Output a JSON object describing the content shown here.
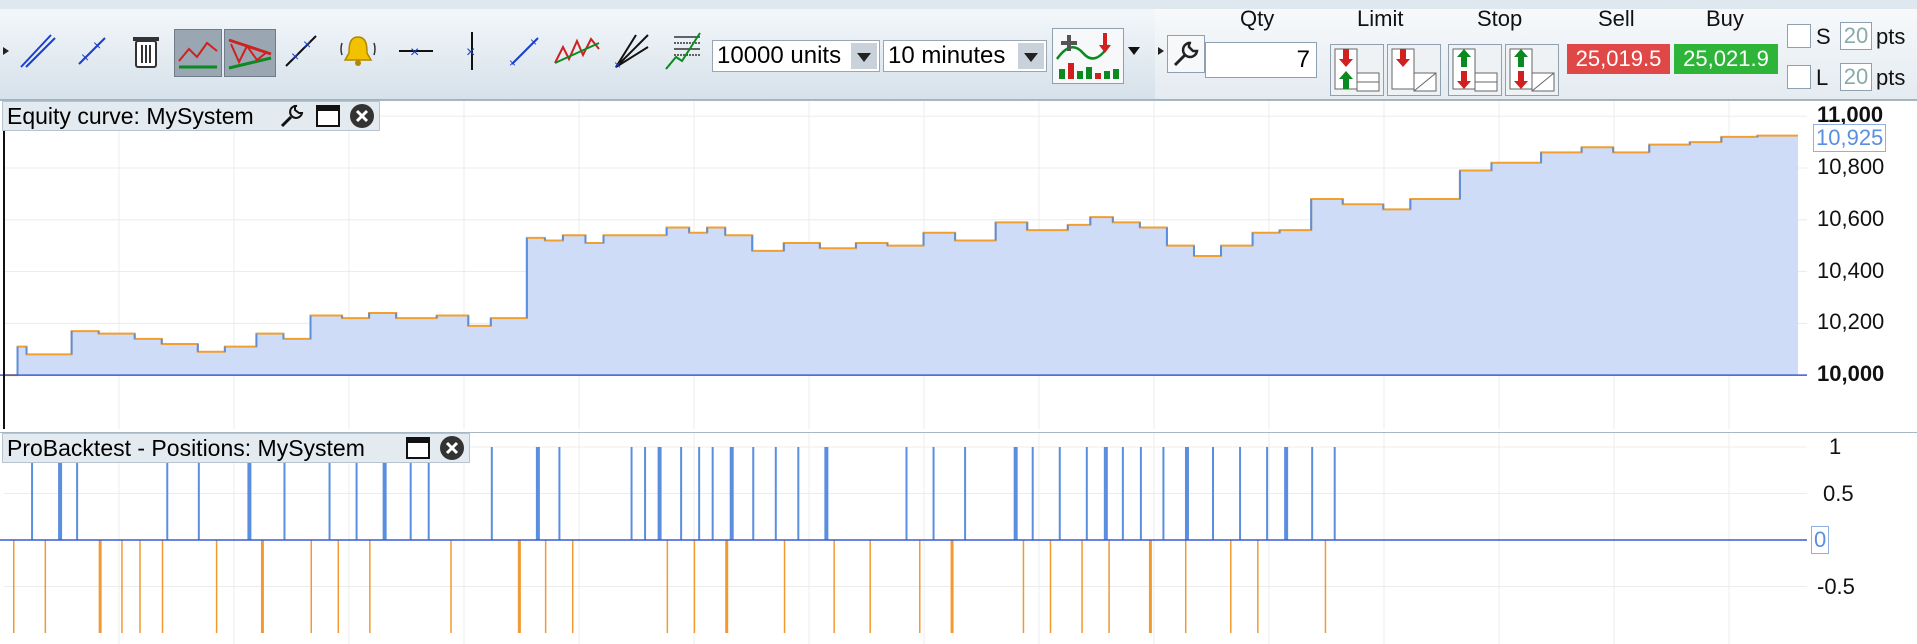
{
  "toolbar": {
    "units_select": "10000 units",
    "interval_select": "10 minutes"
  },
  "order_panel": {
    "qty_label": "Qty",
    "qty_value": "7",
    "limit_label": "Limit",
    "stop_label": "Stop",
    "sell_label": "Sell",
    "buy_label": "Buy",
    "sell_price": "25,019.5",
    "buy_price": "25,021.9",
    "stop_loss_label": "S",
    "take_profit_label": "L",
    "stop_loss_pts": "20",
    "take_profit_pts": "20",
    "pts_label": "pts",
    "sell_color": "#e04848",
    "buy_color": "#2fb43a"
  },
  "equity_panel": {
    "title": "Equity curve: MySystem",
    "current_value": "10,925",
    "y_ticks": [
      "11,000",
      "10,800",
      "10,600",
      "10,400",
      "10,200",
      "10,000"
    ],
    "fill_color": "#cfdcf7",
    "line_color": "#f0a030",
    "baseline_color": "#3b5bd6"
  },
  "positions_panel": {
    "title": "ProBacktest - Positions: MySystem",
    "current_value": "0",
    "y_ticks": [
      "1",
      "0.5",
      "-0.5"
    ],
    "long_color": "#5a8fe0",
    "short_color": "#f09a30"
  },
  "chart_data": [
    {
      "type": "line",
      "title": "Equity curve: MySystem",
      "ylim": [
        9900,
        11020
      ],
      "series": [
        {
          "name": "MySystem",
          "x": [
            0,
            0.3,
            0.5,
            1.5,
            2.1,
            2.9,
            3.5,
            4.3,
            4.9,
            5.6,
            6.2,
            6.8,
            7.5,
            8.1,
            8.7,
            9.6,
            10.3,
            10.8,
            11.6,
            12.0,
            12.4,
            12.9,
            13.3,
            14.7,
            15.2,
            15.6,
            16.0,
            16.6,
            17.3,
            18.1,
            18.9,
            19.6,
            20.4,
            21.1,
            22.0,
            22.7,
            23.6,
            24.1,
            24.6,
            25.2,
            25.8,
            26.4,
            27.0,
            27.7,
            28.3,
            29.0,
            29.7,
            30.6,
            31.2,
            32.3,
            33.0,
            34.1,
            35.0,
            35.7,
            36.5,
            37.4,
            38.1,
            38.9,
            39.8
          ],
          "values": [
            10000,
            10110,
            10080,
            10170,
            10160,
            10140,
            10120,
            10090,
            10110,
            10160,
            10140,
            10230,
            10220,
            10240,
            10220,
            10230,
            10190,
            10220,
            10530,
            10520,
            10540,
            10510,
            10540,
            10570,
            10550,
            10570,
            10540,
            10480,
            10510,
            10490,
            10510,
            10500,
            10550,
            10520,
            10590,
            10560,
            10580,
            10610,
            10590,
            10570,
            10500,
            10460,
            10500,
            10550,
            10560,
            10680,
            10660,
            10640,
            10680,
            10790,
            10820,
            10860,
            10880,
            10860,
            10890,
            10900,
            10920,
            10925,
            10925
          ]
        }
      ],
      "xlabel": "",
      "ylabel": ""
    },
    {
      "type": "bar",
      "title": "ProBacktest - Positions: MySystem",
      "ylim": [
        -1,
        1
      ],
      "series": [
        {
          "name": "long",
          "x": [
            0.6,
            1.2,
            1.6,
            3.6,
            4.3,
            5.4,
            6.2,
            7.2,
            7.8,
            8.4,
            9.0,
            9.4,
            10.8,
            11.8,
            12.3,
            13.9,
            14.2,
            14.5,
            15.0,
            15.4,
            15.7,
            16.1,
            16.6,
            17.1,
            17.6,
            18.2,
            20.0,
            20.6,
            21.3,
            22.4,
            22.8,
            23.4,
            24.0,
            24.4,
            24.8,
            25.2,
            25.7,
            26.2,
            26.8,
            27.4,
            28.0,
            28.4,
            29.0,
            29.5
          ],
          "values": [
            1,
            1,
            1,
            1,
            1,
            1,
            1,
            1,
            1,
            1,
            1,
            1,
            1,
            1,
            1,
            1,
            1,
            1,
            1,
            1,
            1,
            1,
            1,
            1,
            1,
            1,
            1,
            1,
            1,
            1,
            1,
            1,
            1,
            1,
            1,
            1,
            1,
            1,
            1,
            1,
            1,
            1,
            1,
            1
          ]
        },
        {
          "name": "short",
          "x": [
            0.2,
            0.9,
            2.1,
            2.6,
            3.0,
            3.5,
            4.7,
            5.7,
            6.8,
            7.4,
            8.1,
            9.9,
            11.4,
            12.0,
            12.6,
            14.7,
            15.3,
            16.0,
            17.3,
            18.4,
            19.2,
            20.3,
            21.0,
            22.6,
            23.2,
            23.9,
            24.5,
            25.4,
            26.2,
            27.2,
            27.8,
            29.3
          ],
          "values": [
            -1,
            -1,
            -1,
            -1,
            -1,
            -1,
            -1,
            -1,
            -1,
            -1,
            -1,
            -1,
            -1,
            -1,
            -1,
            -1,
            -1,
            -1,
            -1,
            -1,
            -1,
            -1,
            -1,
            -1,
            -1,
            -1,
            -1,
            -1,
            -1,
            -1,
            -1,
            -1
          ]
        }
      ]
    }
  ]
}
